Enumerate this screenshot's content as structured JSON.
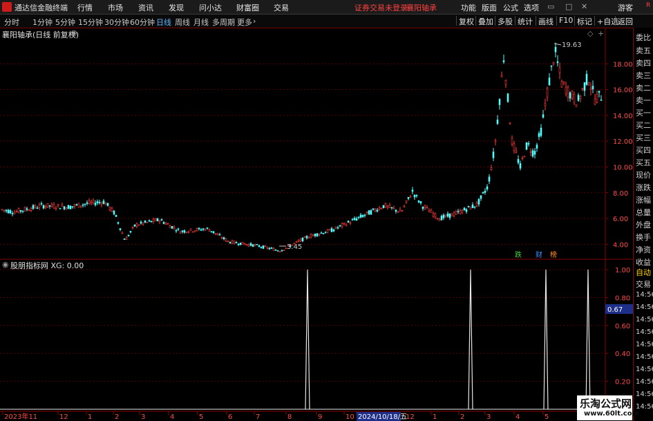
{
  "app": {
    "title": "通达信金融终端",
    "menu": [
      "行情",
      "市场",
      "资讯",
      "发现",
      "问小达",
      "财富圈",
      "交易"
    ],
    "status": "证券交易未登录",
    "stock": "襄阳轴承",
    "right_menu": [
      "功能",
      "版面",
      "公式",
      "选项"
    ],
    "guest": "游客"
  },
  "toolbar": {
    "periods": [
      "分时",
      "1分钟",
      "5分钟",
      "15分钟",
      "30分钟",
      "60分钟",
      "日线",
      "周线",
      "月线",
      "多周期",
      "更多"
    ],
    "active_period": "日线",
    "buttons": [
      "复权",
      "叠加",
      "多股",
      "统计",
      "画线",
      "F10",
      "标记",
      "+自选",
      "返回"
    ]
  },
  "main_chart": {
    "title": "襄阳轴承(日线 前复权)",
    "high_label": "19.63",
    "low_label": "3.45",
    "markers": [
      "跌",
      "财",
      "榜"
    ],
    "marker_colors": [
      "#40d040",
      "#4090ff",
      "#ff9020"
    ],
    "y_ticks": [
      "18.00",
      "16.00",
      "14.00",
      "12.00",
      "10.00",
      "8.00",
      "6.00",
      "4.00"
    ]
  },
  "indicator": {
    "title": "股朋指标网  XG: 0.00",
    "y_ticks": [
      "1.00",
      "0.80",
      "0.67",
      "0.60",
      "0.40",
      "0.20"
    ],
    "cursor_value": "0.67"
  },
  "x_axis": {
    "labels": [
      "2023年11",
      "12",
      "1",
      "2",
      "3",
      "4",
      "5",
      "6",
      "7",
      "8",
      "9",
      "10",
      "2024/10/18/五",
      "12",
      "1",
      "2",
      "3",
      "4",
      "5"
    ]
  },
  "right_panel": {
    "items": [
      "委比",
      "卖五",
      "卖四",
      "卖三",
      "卖二",
      "卖一",
      "买一",
      "买二",
      "买三",
      "买四",
      "买五",
      "现价",
      "涨跌",
      "涨幅",
      "总量",
      "外盘",
      "换手",
      "净资",
      "收益",
      "自动",
      "交易",
      "14:56",
      "14:56",
      "14:56",
      "14:56",
      "14:56",
      "14:56",
      "14:56",
      "14:56",
      "14:56",
      "14:56"
    ]
  },
  "watermark": {
    "text": "乐淘公式网",
    "url": "www.60lt.com"
  },
  "colors": {
    "up": "#ff3c3c",
    "down": "#54fcfc",
    "accent": "#5fb4ff",
    "frame": "#8a0000"
  }
}
